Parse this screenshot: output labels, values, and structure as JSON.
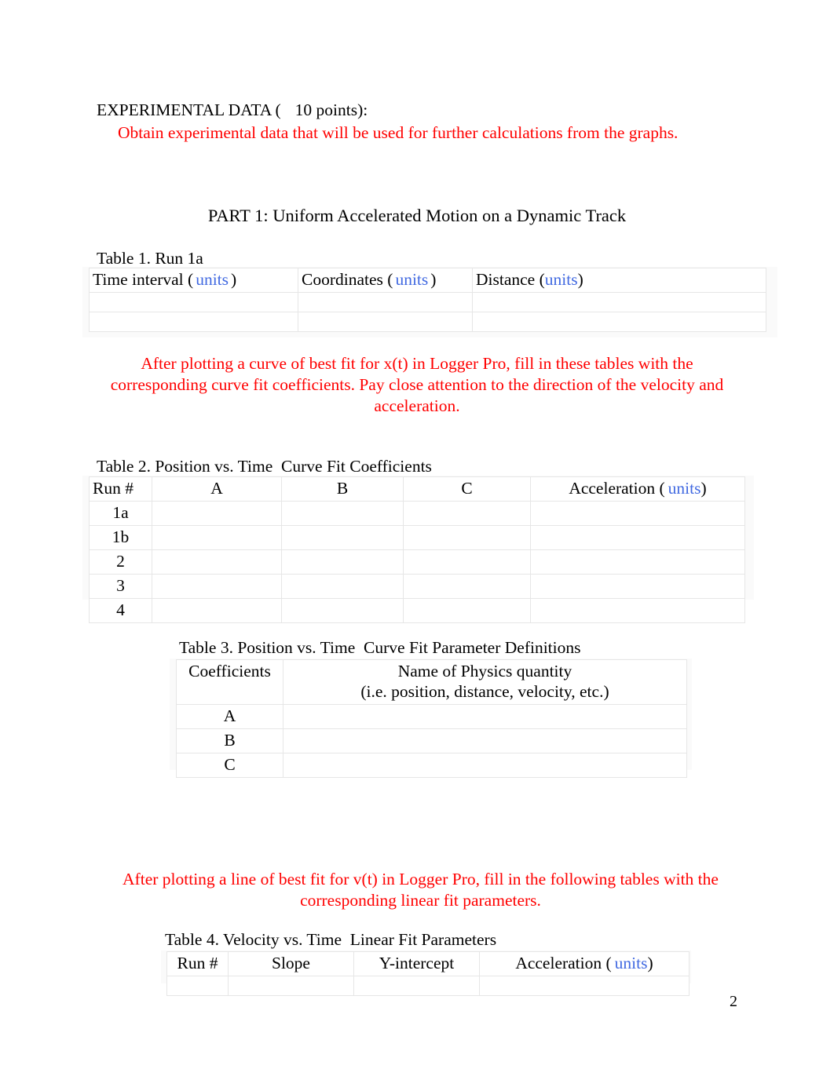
{
  "document": {
    "page_number": "2",
    "colors": {
      "instruction_red": "#FF0000",
      "units_blue": "#4169E1",
      "text_black": "#000000",
      "table_border": "#E6E6E6"
    }
  },
  "section_header": {
    "title": "EXPERIMENTAL DATA (",
    "points": "10 points):",
    "instruction": "Obtain experimental data that will be used for further calculations from the graphs."
  },
  "part_title": "PART 1: Uniform Accelerated Motion on a Dynamic Track",
  "table1": {
    "caption": "Table 1. Run 1a",
    "headers": [
      {
        "label_before": "Time interval (",
        "units": "units",
        "label_after": ")"
      },
      {
        "label_before": "Coordinates (",
        "units": "units",
        "label_after": ")"
      },
      {
        "label_before": "Distance (",
        "units": "units",
        "label_after": ")"
      }
    ],
    "rows": [
      [
        "",
        "",
        ""
      ],
      [
        "",
        "",
        ""
      ]
    ]
  },
  "instruction_curve_fit": "After plotting a curve of best fit for x(t) in Logger Pro, fill in these tables with the corresponding curve fit coefficients. Pay close attention to the direction of the velocity and acceleration.",
  "table2": {
    "caption": "Table 2. Position vs. Time  Curve Fit Coefficients",
    "headers": [
      "Run #",
      "A",
      "B",
      "C"
    ],
    "header_acceleration": {
      "label_before": "Acceleration (",
      "units": "units",
      "label_after": ")"
    },
    "rows": [
      {
        "run": "1a",
        "A": "",
        "B": "",
        "C": "",
        "acceleration": ""
      },
      {
        "run": "1b",
        "A": "",
        "B": "",
        "C": "",
        "acceleration": ""
      },
      {
        "run": "2",
        "A": "",
        "B": "",
        "C": "",
        "acceleration": ""
      },
      {
        "run": "3",
        "A": "",
        "B": "",
        "C": "",
        "acceleration": ""
      },
      {
        "run": "4",
        "A": "",
        "B": "",
        "C": "",
        "acceleration": ""
      }
    ]
  },
  "table3": {
    "caption": "Table 3. Position vs. Time  Curve Fit Parameter Definitions",
    "headers": [
      "Coefficients",
      "Name of Physics quantity\n(i.e. position, distance, velocity, etc.)"
    ],
    "rows": [
      {
        "coefficient": "A",
        "quantity": ""
      },
      {
        "coefficient": "B",
        "quantity": ""
      },
      {
        "coefficient": "C",
        "quantity": ""
      }
    ]
  },
  "instruction_linear_fit": "After plotting a line of best fit for v(t) in Logger Pro, fill in the following tables with the corresponding linear fit parameters.",
  "table4": {
    "caption": "Table 4. Velocity vs. Time  Linear Fit Parameters",
    "headers": [
      "Run #",
      "Slope",
      "Y-intercept"
    ],
    "header_acceleration": {
      "label_before": "Acceleration (",
      "units": "units",
      "label_after": ")"
    }
  }
}
